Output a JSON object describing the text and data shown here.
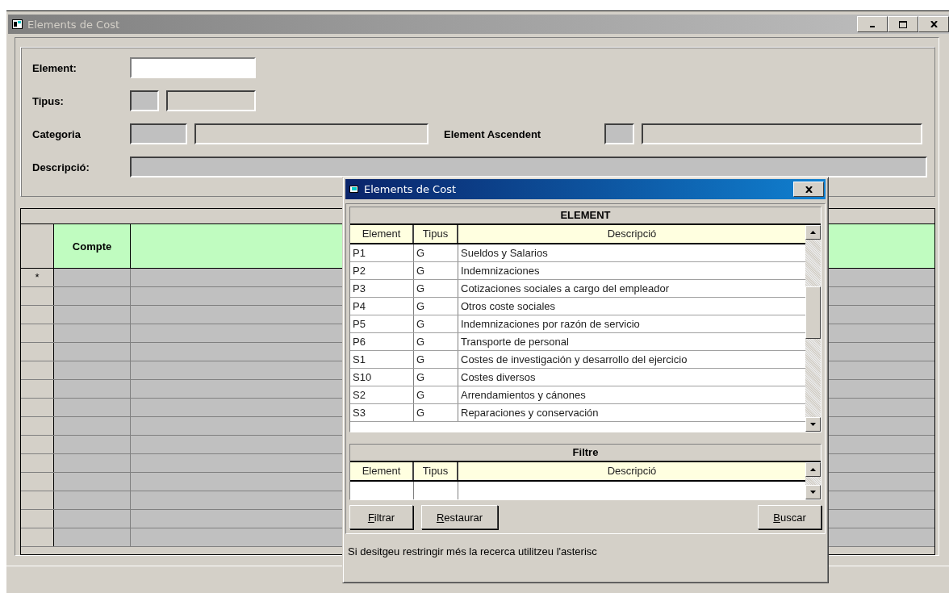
{
  "window": {
    "title": "Elements de Cost"
  },
  "form": {
    "element_label": "Element:",
    "tipus_label": "Tipus:",
    "categoria_label": "Categoria",
    "element_ascendent_label": "Element Ascendent",
    "descripcio_label": "Descripció:"
  },
  "grid": {
    "columns": [
      "Compte"
    ],
    "new_row_marker": "*"
  },
  "dialog": {
    "title": "Elements de Cost",
    "element_table": {
      "title": "ELEMENT",
      "columns": [
        "Element",
        "Tipus",
        "Descripció"
      ],
      "rows": [
        [
          "P1",
          "G",
          "Sueldos y Salarios"
        ],
        [
          "P2",
          "G",
          "Indemnizaciones"
        ],
        [
          "P3",
          "G",
          "Cotizaciones sociales a cargo del empleador"
        ],
        [
          "P4",
          "G",
          "Otros coste sociales"
        ],
        [
          "P5",
          "G",
          "Indemnizaciones por razón de servicio"
        ],
        [
          "P6",
          "G",
          "Transporte de personal"
        ],
        [
          "S1",
          "G",
          "Costes de investigación y desarrollo del ejercicio"
        ],
        [
          "S10",
          "G",
          "Costes diversos"
        ],
        [
          "S2",
          "G",
          "Arrendamientos y cánones"
        ],
        [
          "S3",
          "G",
          "Reparaciones y conservación"
        ]
      ]
    },
    "filter_table": {
      "title": "Filtre",
      "columns": [
        "Element",
        "Tipus",
        "Descripció"
      ]
    },
    "buttons": [
      "Filtrar",
      "Restaurar",
      "Buscar"
    ],
    "hint": "Si desitgeu restringir més la recerca utilitzeu l'asterisc"
  }
}
